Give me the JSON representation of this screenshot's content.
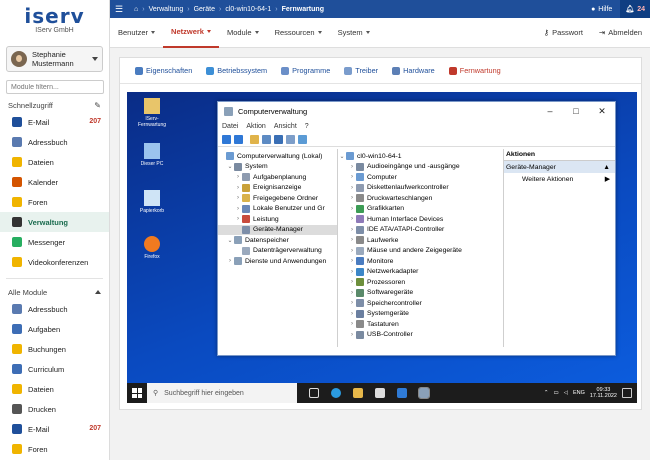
{
  "sidebar": {
    "logo": "iserv",
    "company": "IServ GmbH",
    "user_first": "Stephanie",
    "user_last": "Mustermann",
    "filter_placeholder": "Module filtern...",
    "quick_title": "Schnellzugriff",
    "quick_items": [
      {
        "label": "E-Mail",
        "badge": "207",
        "color": "#1f4f9a"
      },
      {
        "label": "Adressbuch",
        "badge": "",
        "color": "#5a7ab0"
      },
      {
        "label": "Dateien",
        "badge": "",
        "color": "#f0b400"
      },
      {
        "label": "Kalender",
        "badge": "",
        "color": "#d35400"
      },
      {
        "label": "Foren",
        "badge": "",
        "color": "#f0b400"
      },
      {
        "label": "Verwaltung",
        "badge": "",
        "color": "#333333"
      },
      {
        "label": "Messenger",
        "badge": "",
        "color": "#27ae60"
      },
      {
        "label": "Videokonferenzen",
        "badge": "",
        "color": "#f0b400"
      }
    ],
    "all_title": "Alle Module",
    "all_items": [
      {
        "label": "Adressbuch",
        "badge": "",
        "color": "#5a7ab0"
      },
      {
        "label": "Aufgaben",
        "badge": "",
        "color": "#3d6db5"
      },
      {
        "label": "Buchungen",
        "badge": "",
        "color": "#f0b400"
      },
      {
        "label": "Curriculum",
        "badge": "",
        "color": "#3d6db5"
      },
      {
        "label": "Dateien",
        "badge": "",
        "color": "#f0b400"
      },
      {
        "label": "Drucken",
        "badge": "",
        "color": "#555555"
      },
      {
        "label": "E-Mail",
        "badge": "207",
        "color": "#1f4f9a"
      },
      {
        "label": "Foren",
        "badge": "",
        "color": "#f0b400"
      }
    ]
  },
  "topbar": {
    "breadcrumb": [
      "Verwaltung",
      "Geräte",
      "cl0-win10-64-1",
      "Fernwartung"
    ],
    "help": "Hilfe",
    "notifications": "24"
  },
  "tabs": {
    "items": [
      "Benutzer",
      "Netzwerk",
      "Module",
      "Ressourcen",
      "System"
    ],
    "active_index": 1,
    "password": "Passwort",
    "logout": "Abmelden"
  },
  "subtabs": {
    "items": [
      "Eigenschaften",
      "Betriebssystem",
      "Programme",
      "Treiber",
      "Hardware",
      "Fernwartung"
    ],
    "active_index": 5
  },
  "desktop": {
    "icons": [
      "IServ-Fernwartung",
      "Dieser PC",
      "Papierkorb",
      "Firefox"
    ]
  },
  "window": {
    "title": "Computerverwaltung",
    "controls": [
      "–",
      "□",
      "✕"
    ],
    "menu": [
      "Datei",
      "Aktion",
      "Ansicht",
      "?"
    ],
    "tree": [
      {
        "label": "Computerverwaltung (Lokal)",
        "level": 0,
        "twisty": ""
      },
      {
        "label": "System",
        "level": 1,
        "twisty": "⌄"
      },
      {
        "label": "Aufgabenplanung",
        "level": 2,
        "twisty": "›"
      },
      {
        "label": "Ereignisanzeige",
        "level": 2,
        "twisty": "›"
      },
      {
        "label": "Freigegebene Ordner",
        "level": 2,
        "twisty": "›"
      },
      {
        "label": "Lokale Benutzer und Gr",
        "level": 2,
        "twisty": "›"
      },
      {
        "label": "Leistung",
        "level": 2,
        "twisty": "›"
      },
      {
        "label": "Geräte-Manager",
        "level": 2,
        "twisty": "",
        "selected": true
      },
      {
        "label": "Datenspeicher",
        "level": 1,
        "twisty": "⌄"
      },
      {
        "label": "Datenträgerverwaltung",
        "level": 2,
        "twisty": ""
      },
      {
        "label": "Dienste und Anwendungen",
        "level": 1,
        "twisty": "›"
      }
    ],
    "device_root": "cl0-win10-64-1",
    "devices": [
      "Audioeingänge und -ausgänge",
      "Computer",
      "Diskettenlaufwerkcontroller",
      "Druckwarteschlangen",
      "Grafikkarten",
      "Human Interface Devices",
      "IDE ATA/ATAPI-Controller",
      "Laufwerke",
      "Mäuse und andere Zeigegeräte",
      "Monitore",
      "Netzwerkadapter",
      "Prozessoren",
      "Softwaregeräte",
      "Speichercontroller",
      "Systemgeräte",
      "Tastaturen",
      "USB-Controller"
    ],
    "actions_title": "Aktionen",
    "actions_selected": "Geräte-Manager",
    "actions_more": "Weitere Aktionen"
  },
  "taskbar": {
    "search": "Suchbegriff hier eingeben",
    "lang": "ENG",
    "time": "09:33",
    "date": "17.11.2022"
  }
}
